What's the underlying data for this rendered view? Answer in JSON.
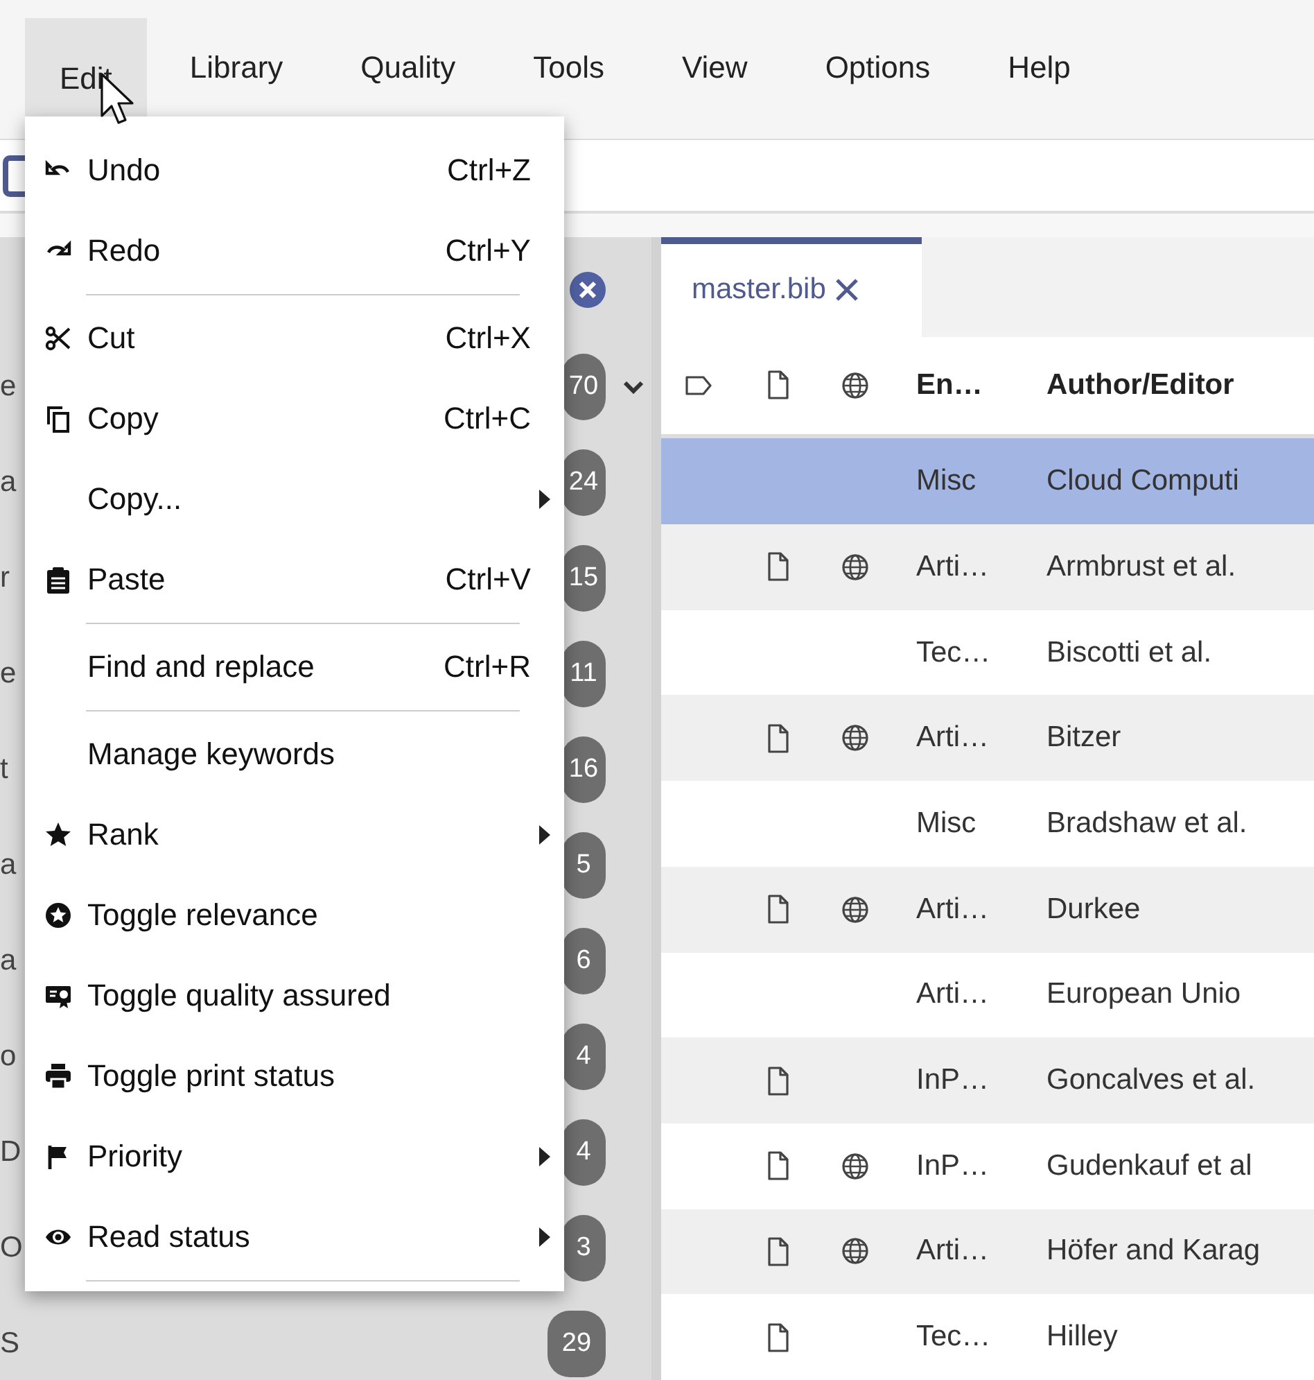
{
  "menu_bar": [
    {
      "label": "Edit",
      "selected": true
    },
    {
      "label": "Library",
      "selected": false
    },
    {
      "label": "Quality",
      "selected": false
    },
    {
      "label": "Tools",
      "selected": false
    },
    {
      "label": "View",
      "selected": false
    },
    {
      "label": "Options",
      "selected": false
    },
    {
      "label": "Help",
      "selected": false
    }
  ],
  "edit_menu": [
    {
      "kind": "command",
      "label": "Undo",
      "shortcut": "Ctrl+Z"
    },
    {
      "kind": "command",
      "label": "Redo",
      "shortcut": "Ctrl+Y"
    },
    {
      "kind": "separator"
    },
    {
      "kind": "command",
      "label": "Cut",
      "shortcut": "Ctrl+X"
    },
    {
      "kind": "command",
      "label": "Copy",
      "shortcut": "Ctrl+C"
    },
    {
      "kind": "submenu",
      "label": "Copy..."
    },
    {
      "kind": "command",
      "label": "Paste",
      "shortcut": "Ctrl+V"
    },
    {
      "kind": "separator"
    },
    {
      "kind": "command",
      "label": "Find and replace",
      "shortcut": "Ctrl+R"
    },
    {
      "kind": "separator"
    },
    {
      "kind": "command",
      "label": "Manage keywords"
    },
    {
      "kind": "submenu",
      "label": "Rank"
    },
    {
      "kind": "command",
      "label": "Toggle relevance"
    },
    {
      "kind": "command",
      "label": "Toggle quality assured"
    },
    {
      "kind": "command",
      "label": "Toggle print status"
    },
    {
      "kind": "submenu",
      "label": "Priority"
    },
    {
      "kind": "submenu",
      "label": "Read status"
    },
    {
      "kind": "separator"
    }
  ],
  "sidebar": {
    "items": [
      {
        "label": "e",
        "count": "70",
        "expandable": true
      },
      {
        "label": "a",
        "count": "24"
      },
      {
        "label": "r",
        "count": "15"
      },
      {
        "label": "e",
        "count": "11"
      },
      {
        "label": "t",
        "count": "16"
      },
      {
        "label": "a",
        "count": "5"
      },
      {
        "label": "a",
        "count": "6"
      },
      {
        "label": "o",
        "count": "4"
      },
      {
        "label": "D",
        "count": "4"
      },
      {
        "label": "O",
        "count": "3"
      },
      {
        "label": "S",
        "count": "29"
      }
    ]
  },
  "tabs": [
    {
      "label": "master.bib",
      "selected": true
    }
  ],
  "table": {
    "columns": [
      {
        "kind": "icon"
      },
      {
        "kind": "icon"
      },
      {
        "kind": "icon"
      },
      {
        "kind": "text",
        "label": "En…"
      },
      {
        "kind": "text",
        "label": "Author/Editor"
      }
    ],
    "rows": [
      {
        "file": false,
        "link": false,
        "type": "Misc",
        "author": "Cloud Computi",
        "selected": true
      },
      {
        "file": true,
        "link": true,
        "type": "Arti…",
        "author": "Armbrust et al.",
        "selected": false
      },
      {
        "file": false,
        "link": false,
        "type": "Tec…",
        "author": "Biscotti et al.",
        "selected": false
      },
      {
        "file": true,
        "link": true,
        "type": "Arti…",
        "author": "Bitzer",
        "selected": false
      },
      {
        "file": false,
        "link": false,
        "type": "Misc",
        "author": "Bradshaw et al.",
        "selected": false
      },
      {
        "file": true,
        "link": true,
        "type": "Arti…",
        "author": "Durkee",
        "selected": false
      },
      {
        "file": false,
        "link": false,
        "type": "Arti…",
        "author": "European Unio",
        "selected": false
      },
      {
        "file": true,
        "link": false,
        "type": "InP…",
        "author": "Goncalves et al.",
        "selected": false
      },
      {
        "file": true,
        "link": true,
        "type": "InP…",
        "author": "Gudenkauf et al",
        "selected": false
      },
      {
        "file": true,
        "link": true,
        "type": "Arti…",
        "author": "Höfer and Karag",
        "selected": false
      },
      {
        "file": true,
        "link": false,
        "type": "Tec…",
        "author": "Hilley",
        "selected": false
      }
    ]
  }
}
